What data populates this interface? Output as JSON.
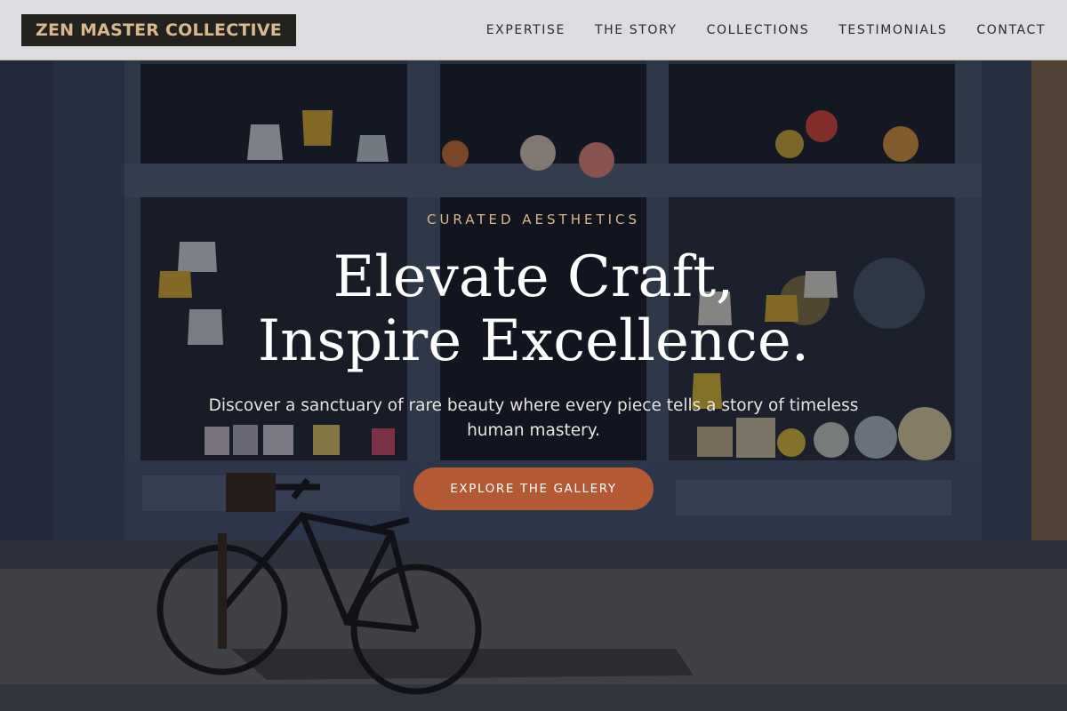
{
  "header": {
    "logo": "ZEN MASTER COLLECTIVE",
    "nav": [
      "EXPERTISE",
      "THE STORY",
      "COLLECTIONS",
      "TESTIMONIALS",
      "CONTACT"
    ]
  },
  "hero": {
    "eyebrow": "CURATED AESTHETICS",
    "title_line1": "Elevate Craft,",
    "title_line2": "Inspire Excellence.",
    "subtitle": "Discover a sanctuary of rare beauty where every piece tells a story of timeless human mastery.",
    "cta": "EXPLORE THE GALLERY"
  },
  "colors": {
    "accent": "#b35a34",
    "gold": "#d8b98c",
    "header_bg": "#dcdde0",
    "logo_bg": "#24221f"
  }
}
